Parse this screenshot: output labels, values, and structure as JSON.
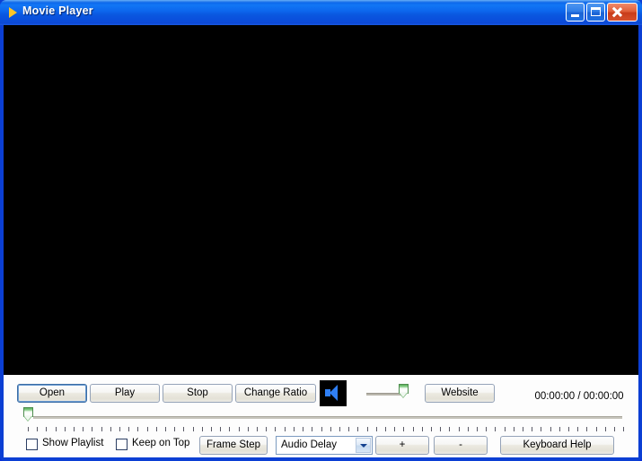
{
  "window": {
    "title": "Movie Player",
    "icon": "play-triangle-icon",
    "controls": {
      "minimize": "Minimize",
      "maximize": "Maximize",
      "close": "Close"
    },
    "accent_titlebar": "#0d68ee",
    "accent_frame": "#0b3fd4",
    "close_color": "#c83c1a"
  },
  "video": {
    "background": "#000000",
    "content": ""
  },
  "controls": {
    "open_label": "Open",
    "play_label": "Play",
    "stop_label": "Stop",
    "change_ratio_label": "Change Ratio",
    "website_label": "Website",
    "speaker_icon": "speaker-icon",
    "speaker_color": "#2f7ff5",
    "volume": {
      "name": "volume-slider",
      "position_percent": 100
    },
    "time_display": "00:00:00 / 00:00:00",
    "elapsed": "00:00:00",
    "duration": "00:00:00",
    "seek": {
      "name": "seek-slider",
      "position_percent": 0,
      "tick_count": 66
    }
  },
  "bottom": {
    "show_playlist_label": "Show Playlist",
    "show_playlist_checked": false,
    "keep_on_top_label": "Keep on Top",
    "keep_on_top_checked": false,
    "frame_step_label": "Frame Step",
    "audio_delay_selected": "Audio Delay",
    "audio_delay_options": [
      "Audio Delay"
    ],
    "plus_label": "+",
    "minus_label": "-",
    "keyboard_help_label": "Keyboard Help"
  }
}
